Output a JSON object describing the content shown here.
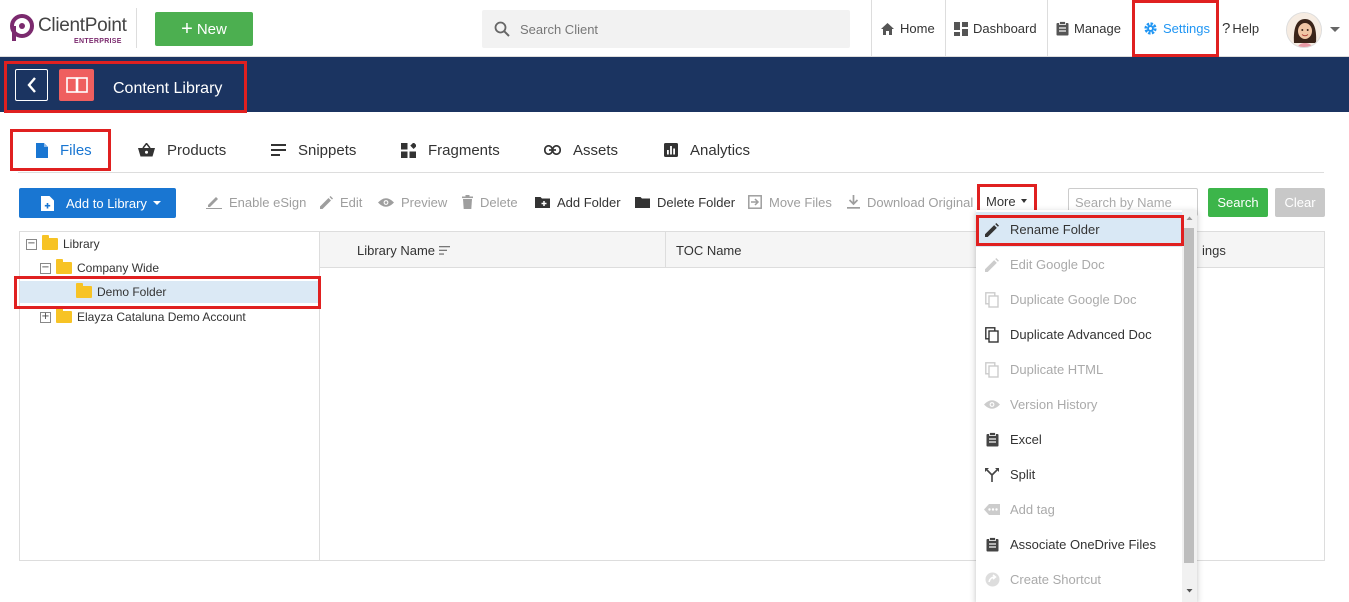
{
  "header": {
    "logo_text": "ClientPoint",
    "logo_sub": "ENTERPRISE",
    "new_label": "New",
    "search_placeholder": "Search Client",
    "nav": {
      "home": "Home",
      "dashboard": "Dashboard",
      "manage": "Manage",
      "settings": "Settings",
      "help": "Help"
    }
  },
  "titlebar": {
    "title": "Content Library"
  },
  "tabs": [
    {
      "label": "Files",
      "icon": "file-icon",
      "active": true
    },
    {
      "label": "Products",
      "icon": "basket-icon"
    },
    {
      "label": "Snippets",
      "icon": "snippets-icon"
    },
    {
      "label": "Fragments",
      "icon": "fragments-icon"
    },
    {
      "label": "Assets",
      "icon": "link-icon"
    },
    {
      "label": "Analytics",
      "icon": "chart-icon"
    }
  ],
  "toolbar": {
    "add_to_library": "Add to Library",
    "enable_esign": "Enable eSign",
    "edit": "Edit",
    "preview": "Preview",
    "delete": "Delete",
    "add_folder": "Add Folder",
    "delete_folder": "Delete Folder",
    "move_files": "Move Files",
    "download_original": "Download Original",
    "more": "More",
    "search_placeholder": "Search by Name",
    "search": "Search",
    "clear": "Clear"
  },
  "tree": {
    "root": "Library",
    "company_wide": "Company Wide",
    "demo_folder": "Demo Folder",
    "elayza": "Elayza Cataluna Demo Account",
    "expanded_sign": "−",
    "collapsed_sign": "+"
  },
  "grid": {
    "col_library_name": "Library Name",
    "col_toc_name": "TOC Name",
    "col_partial": "ings"
  },
  "more_menu": [
    {
      "label": "Rename Folder",
      "icon": "pencil-icon",
      "enabled": true,
      "highlighted": true
    },
    {
      "label": "Edit Google Doc",
      "icon": "pencil-icon",
      "enabled": false
    },
    {
      "label": "Duplicate Google Doc",
      "icon": "copy-icon",
      "enabled": false
    },
    {
      "label": "Duplicate Advanced Doc",
      "icon": "copy-icon",
      "enabled": true
    },
    {
      "label": "Duplicate HTML",
      "icon": "copy-icon",
      "enabled": false
    },
    {
      "label": "Version History",
      "icon": "eye-icon",
      "enabled": false
    },
    {
      "label": "Excel",
      "icon": "clipboard-icon",
      "enabled": true
    },
    {
      "label": "Split",
      "icon": "split-icon",
      "enabled": true
    },
    {
      "label": "Add tag",
      "icon": "tag-icon",
      "enabled": false
    },
    {
      "label": "Associate OneDrive Files",
      "icon": "clipboard-icon",
      "enabled": true
    },
    {
      "label": "Create Shortcut",
      "icon": "shortcut-icon",
      "enabled": false
    }
  ],
  "colors": {
    "brand_navy": "#1b3461",
    "primary_blue": "#1976d2",
    "green": "#4caf50",
    "highlight_red": "#e02020"
  }
}
